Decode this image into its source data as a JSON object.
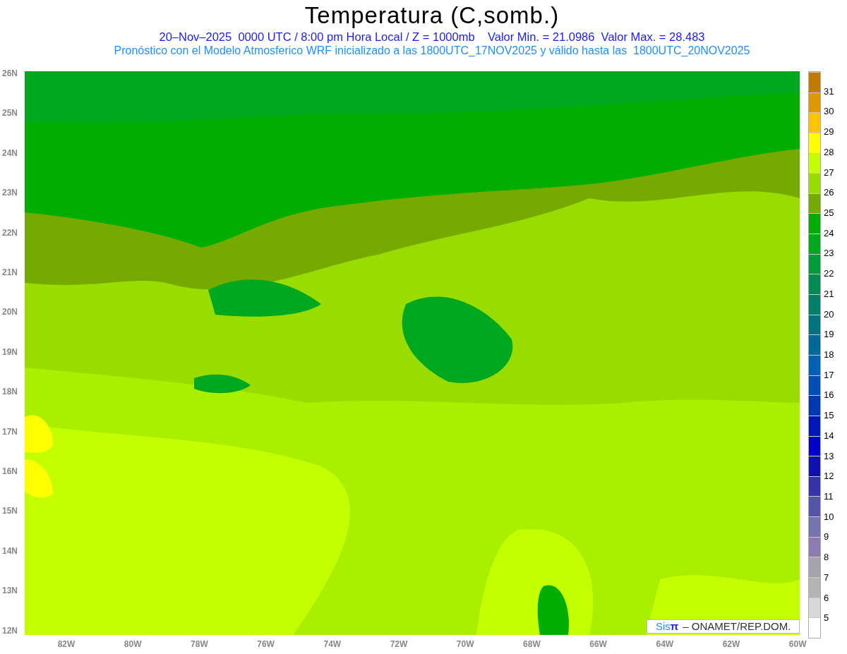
{
  "title": "Temperatura (C,somb.)",
  "subtitle": "20–Nov–2025  0000 UTC / 8:00 pm Hora Local / Z = 1000mb    Valor Min. = 21.0986  Valor Max. = 28.483",
  "description": "Pronóstico con el Modelo Atmosferico WRF inicializado a las 1800UTC_17NOV2025 y válido hasta las  1800UTC_20NOV2025",
  "y_axis_labels": [
    "26N",
    "25N",
    "24N",
    "23N",
    "22N",
    "21N",
    "20N",
    "19N",
    "18N",
    "17N",
    "16N",
    "15N",
    "14N",
    "13N",
    "12N"
  ],
  "x_axis_labels": [
    "82W",
    "80W",
    "78W",
    "76W",
    "74W",
    "72W",
    "70W",
    "68W",
    "66W",
    "64W",
    "62W",
    "60W"
  ],
  "colorbar": {
    "swatches": [
      {
        "color": "#c07c00"
      },
      {
        "color": "#e09800"
      },
      {
        "color": "#ffc400"
      },
      {
        "color": "#ffff00"
      },
      {
        "color": "#c4ff00"
      },
      {
        "color": "#99dd00"
      },
      {
        "color": "#77aa00"
      },
      {
        "color": "#00ad00"
      },
      {
        "color": "#00a820"
      },
      {
        "color": "#009a3c"
      },
      {
        "color": "#008c50"
      },
      {
        "color": "#007f68"
      },
      {
        "color": "#00737c"
      },
      {
        "color": "#006896"
      },
      {
        "color": "#0060b4"
      },
      {
        "color": "#0050b4"
      },
      {
        "color": "#0038b0"
      },
      {
        "color": "#0018b8"
      },
      {
        "color": "#0000c8"
      },
      {
        "color": "#1010b0"
      },
      {
        "color": "#3434a8"
      },
      {
        "color": "#5454a8"
      },
      {
        "color": "#7474b0"
      },
      {
        "color": "#8c7cb0"
      },
      {
        "color": "#a4a4ac"
      },
      {
        "color": "#b4b4b4"
      },
      {
        "color": "#d8d8d8"
      },
      {
        "color": "#ffffff"
      }
    ],
    "labels": [
      "31",
      "30",
      "29",
      "28",
      "27",
      "26",
      "25",
      "24",
      "23",
      "22",
      "21",
      "20",
      "19",
      "18",
      "17",
      "16",
      "15",
      "14",
      "13",
      "12",
      "11",
      "10",
      "9",
      "8",
      "7",
      "6",
      "5"
    ]
  },
  "credit": {
    "brand": "Sis",
    "symbol": "π",
    "text": "– ONAMET/REP.DOM."
  }
}
